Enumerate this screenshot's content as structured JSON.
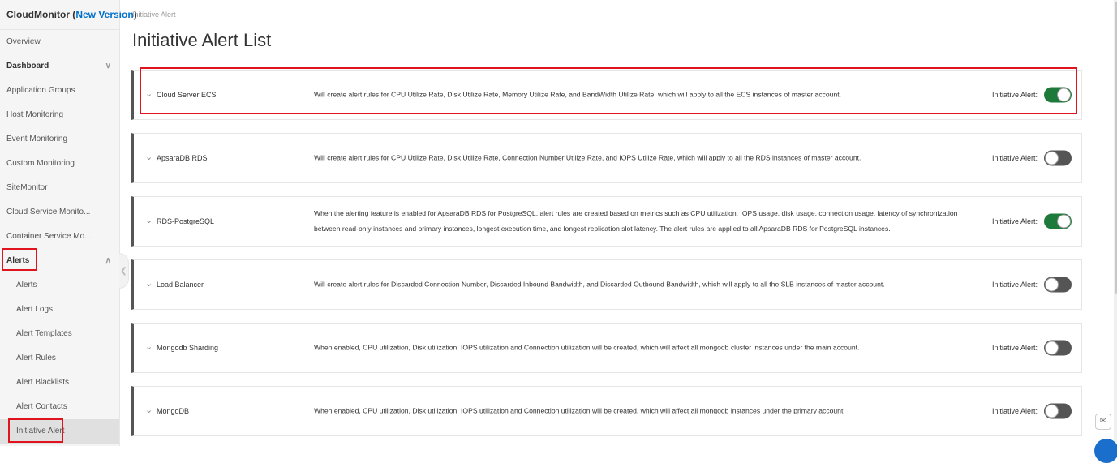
{
  "sidebar": {
    "title_main": "CloudMonitor (",
    "title_blue": "New Version",
    "title_end": ")",
    "items": [
      {
        "label": "Overview"
      },
      {
        "label": "Dashboard",
        "chevron": "∨"
      },
      {
        "label": "Application Groups"
      },
      {
        "label": "Host Monitoring"
      },
      {
        "label": "Event Monitoring"
      },
      {
        "label": "Custom Monitoring"
      },
      {
        "label": "SiteMonitor"
      },
      {
        "label": "Cloud Service Monito..."
      },
      {
        "label": "Container Service Mo..."
      },
      {
        "label": "Alerts",
        "chevron": "∧"
      }
    ],
    "sub_items": [
      {
        "label": "Alerts"
      },
      {
        "label": "Alert Logs"
      },
      {
        "label": "Alert Templates"
      },
      {
        "label": "Alert Rules"
      },
      {
        "label": "Alert Blacklists"
      },
      {
        "label": "Alert Contacts"
      },
      {
        "label": "Initiative Alert"
      }
    ]
  },
  "breadcrumb": "Initiative Alert",
  "page_title": "Initiative Alert List",
  "toggle_label": "Initiative Alert:",
  "cards": [
    {
      "name": "Cloud Server ECS",
      "description": "Will create alert rules for CPU Utilize Rate, Disk Utilize Rate, Memory Utilize Rate, and BandWidth Utilize Rate, which will apply to all the ECS instances of master account.",
      "enabled": true
    },
    {
      "name": "ApsaraDB RDS",
      "description": "Will create alert rules for CPU Utilize Rate, Disk Utilize Rate, Connection Number Utilize Rate, and IOPS Utilize Rate, which will apply to all the RDS instances of master account.",
      "enabled": false
    },
    {
      "name": "RDS-PostgreSQL",
      "description": "When the alerting feature is enabled for ApsaraDB RDS for PostgreSQL, alert rules are created based on metrics such as CPU utilization, IOPS usage, disk usage, connection usage, latency of synchronization between read-only instances and primary instances, longest execution time, and longest replication slot latency. The alert rules are applied to all ApsaraDB RDS for PostgreSQL instances.",
      "enabled": true
    },
    {
      "name": "Load Balancer",
      "description": "Will create alert rules for Discarded Connection Number, Discarded Inbound Bandwidth, and Discarded Outbound Bandwidth, which will apply to all the SLB instances of master account.",
      "enabled": false
    },
    {
      "name": "Mongodb Sharding",
      "description": "When enabled, CPU utilization, Disk utilization, IOPS utilization and Connection utilization will be created, which will affect all mongodb cluster instances under the main account.",
      "enabled": false
    },
    {
      "name": "MongoDB",
      "description": "When enabled, CPU utilization, Disk utilization, IOPS utilization and Connection utilization will be created, which will affect all mongodb instances under the primary account.",
      "enabled": false
    }
  ],
  "icons": {
    "chevron": "chevron-down-icon",
    "collapse": "chevron-left-icon",
    "feedback": "chat-icon"
  },
  "colors": {
    "toggle_on": "#1e7a3a",
    "toggle_off": "#555555",
    "highlight": "#e0141e",
    "brand_blue": "#0070cc"
  }
}
